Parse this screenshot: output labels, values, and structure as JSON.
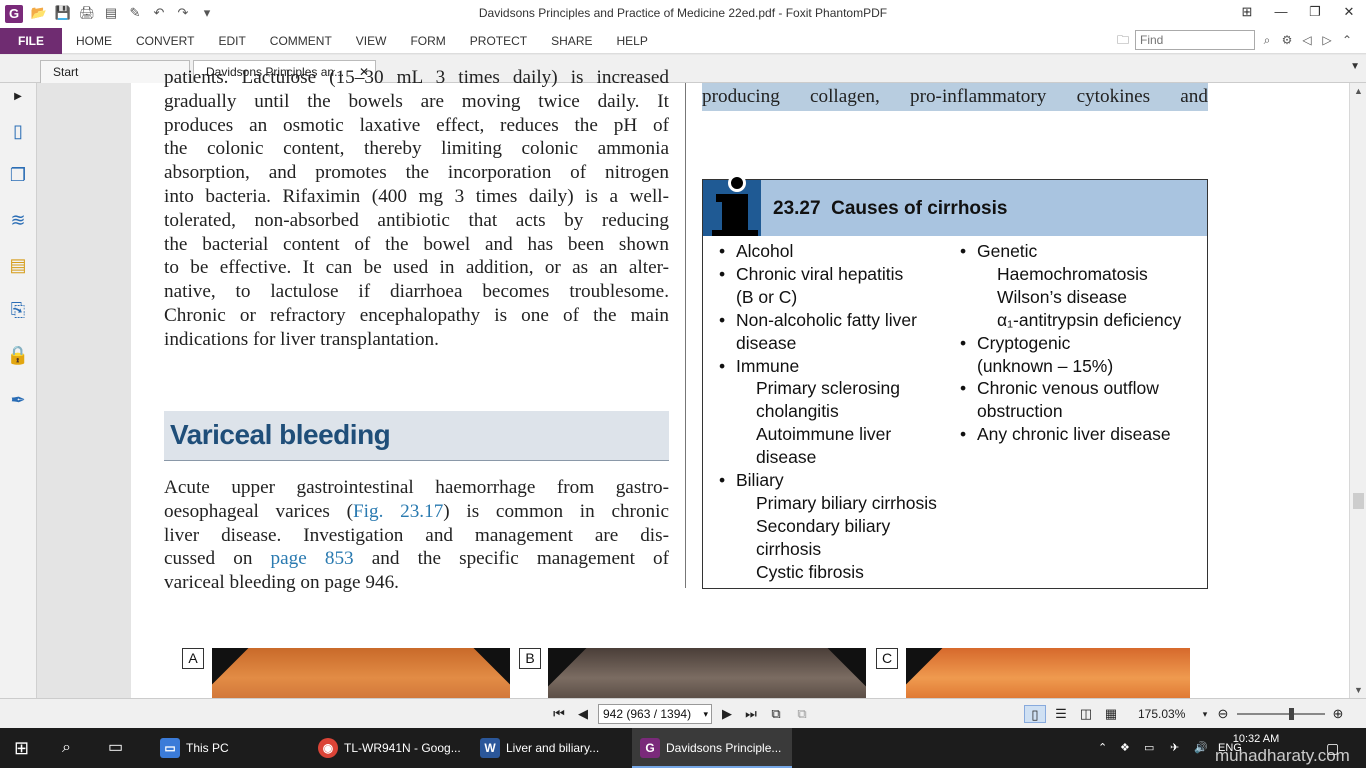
{
  "window": {
    "title": "Davidsons Principles and Practice of Medicine 22ed.pdf - Foxit PhantomPDF",
    "app_icon_letter": "G"
  },
  "menu": {
    "file": "FILE",
    "tabs": [
      "HOME",
      "CONVERT",
      "EDIT",
      "COMMENT",
      "VIEW",
      "FORM",
      "PROTECT",
      "SHARE",
      "HELP"
    ],
    "find_placeholder": "Find"
  },
  "tabs": {
    "start": "Start",
    "active": "Davidsons Principles an...",
    "close_glyph": "✕"
  },
  "document": {
    "left_col_lines": [
      "patients. Lactulose (15–30 mL 3 times daily) is increased",
      "gradually until the bowels are moving twice daily. It",
      "produces an osmotic laxative effect, reduces the pH of",
      "the colonic content, thereby limiting colonic ammonia",
      "absorption, and promotes the incorporation of nitrogen",
      "into bacteria. Rifaximin (400 mg 3 times daily) is a well-",
      "tolerated, non-absorbed antibiotic that acts by reducing",
      "the bacterial content of the bowel and has been shown",
      "to be effective. It can be used in addition, or as an alter-",
      "native, to lactulose if diarrhoea becomes troublesome.",
      "Chronic or refractory encephalopathy is one of the main",
      "indications for liver transplantation."
    ],
    "heading": "Variceal bleeding",
    "para2": {
      "l1": "Acute upper gastrointestinal haemorrhage from gastro-",
      "l2a": "oesophageal varices (",
      "l2link": "Fig. 23.17",
      "l2b": ") is common in chronic",
      "l3": "liver disease. Investigation and management are dis-",
      "l4a": "cussed on ",
      "l4link": "page 853",
      "l4b": " and the specific management of",
      "l5": "variceal bleeding on page 946."
    },
    "right_top_line": "producing collagen, pro-inflammatory cytokines and",
    "box": {
      "number": "23.27",
      "title": "Causes of cirrhosis",
      "bullet": "•",
      "left": [
        {
          "text": "Alcohol",
          "bullet": true
        },
        {
          "text": "Chronic viral hepatitis",
          "bullet": true
        },
        {
          "text": "(B or C)",
          "bullet": false
        },
        {
          "text": "Non-alcoholic fatty liver",
          "bullet": true
        },
        {
          "text": "disease",
          "bullet": false
        },
        {
          "text": "Immune",
          "bullet": true
        },
        {
          "text": "Primary sclerosing",
          "indent": true
        },
        {
          "text": "cholangitis",
          "indent": true
        },
        {
          "text": "Autoimmune liver",
          "indent": true
        },
        {
          "text": "disease",
          "indent": true
        },
        {
          "text": "Biliary",
          "bullet": true
        },
        {
          "text": "Primary biliary cirrhosis",
          "indent": true
        },
        {
          "text": "Secondary biliary",
          "indent": true
        },
        {
          "text": "cirrhosis",
          "indent": true
        },
        {
          "text": "Cystic fibrosis",
          "indent": true
        }
      ],
      "right": [
        {
          "text": "Genetic",
          "bullet": true
        },
        {
          "text": "Haemochromatosis",
          "indent": true
        },
        {
          "text": "Wilson’s disease",
          "indent": true
        },
        {
          "text": "α₁-antitrypsin deficiency",
          "indent": true
        },
        {
          "text": "Cryptogenic",
          "bullet": true
        },
        {
          "text": "(unknown – 15%)",
          "bullet": false
        },
        {
          "text": "Chronic venous outflow",
          "bullet": true
        },
        {
          "text": "obstruction",
          "bullet": false
        },
        {
          "text": "Any chronic liver disease",
          "bullet": true
        }
      ]
    },
    "figure_labels": [
      "A",
      "B",
      "C"
    ]
  },
  "statusbar": {
    "page_value": "942 (963 / 1394)",
    "zoom": "175.03%"
  },
  "taskbar": {
    "tasks": [
      {
        "label": "This PC",
        "icon": "folder-icon"
      },
      {
        "label": "TL-WR941N - Goog...",
        "icon": "chrome-icon"
      },
      {
        "label": "Liver    and biliary...",
        "icon": "word-icon"
      },
      {
        "label": "Davidsons Principle...",
        "icon": "foxit-icon"
      }
    ],
    "lang": "ENG",
    "time": "10:32 AM",
    "watermark": "muhadharaty.com"
  },
  "colors": {
    "file_tab": "#6f2c71",
    "heading": "#1f4e79",
    "box_header": "#a9c4e0",
    "link": "#2a7ab0"
  }
}
